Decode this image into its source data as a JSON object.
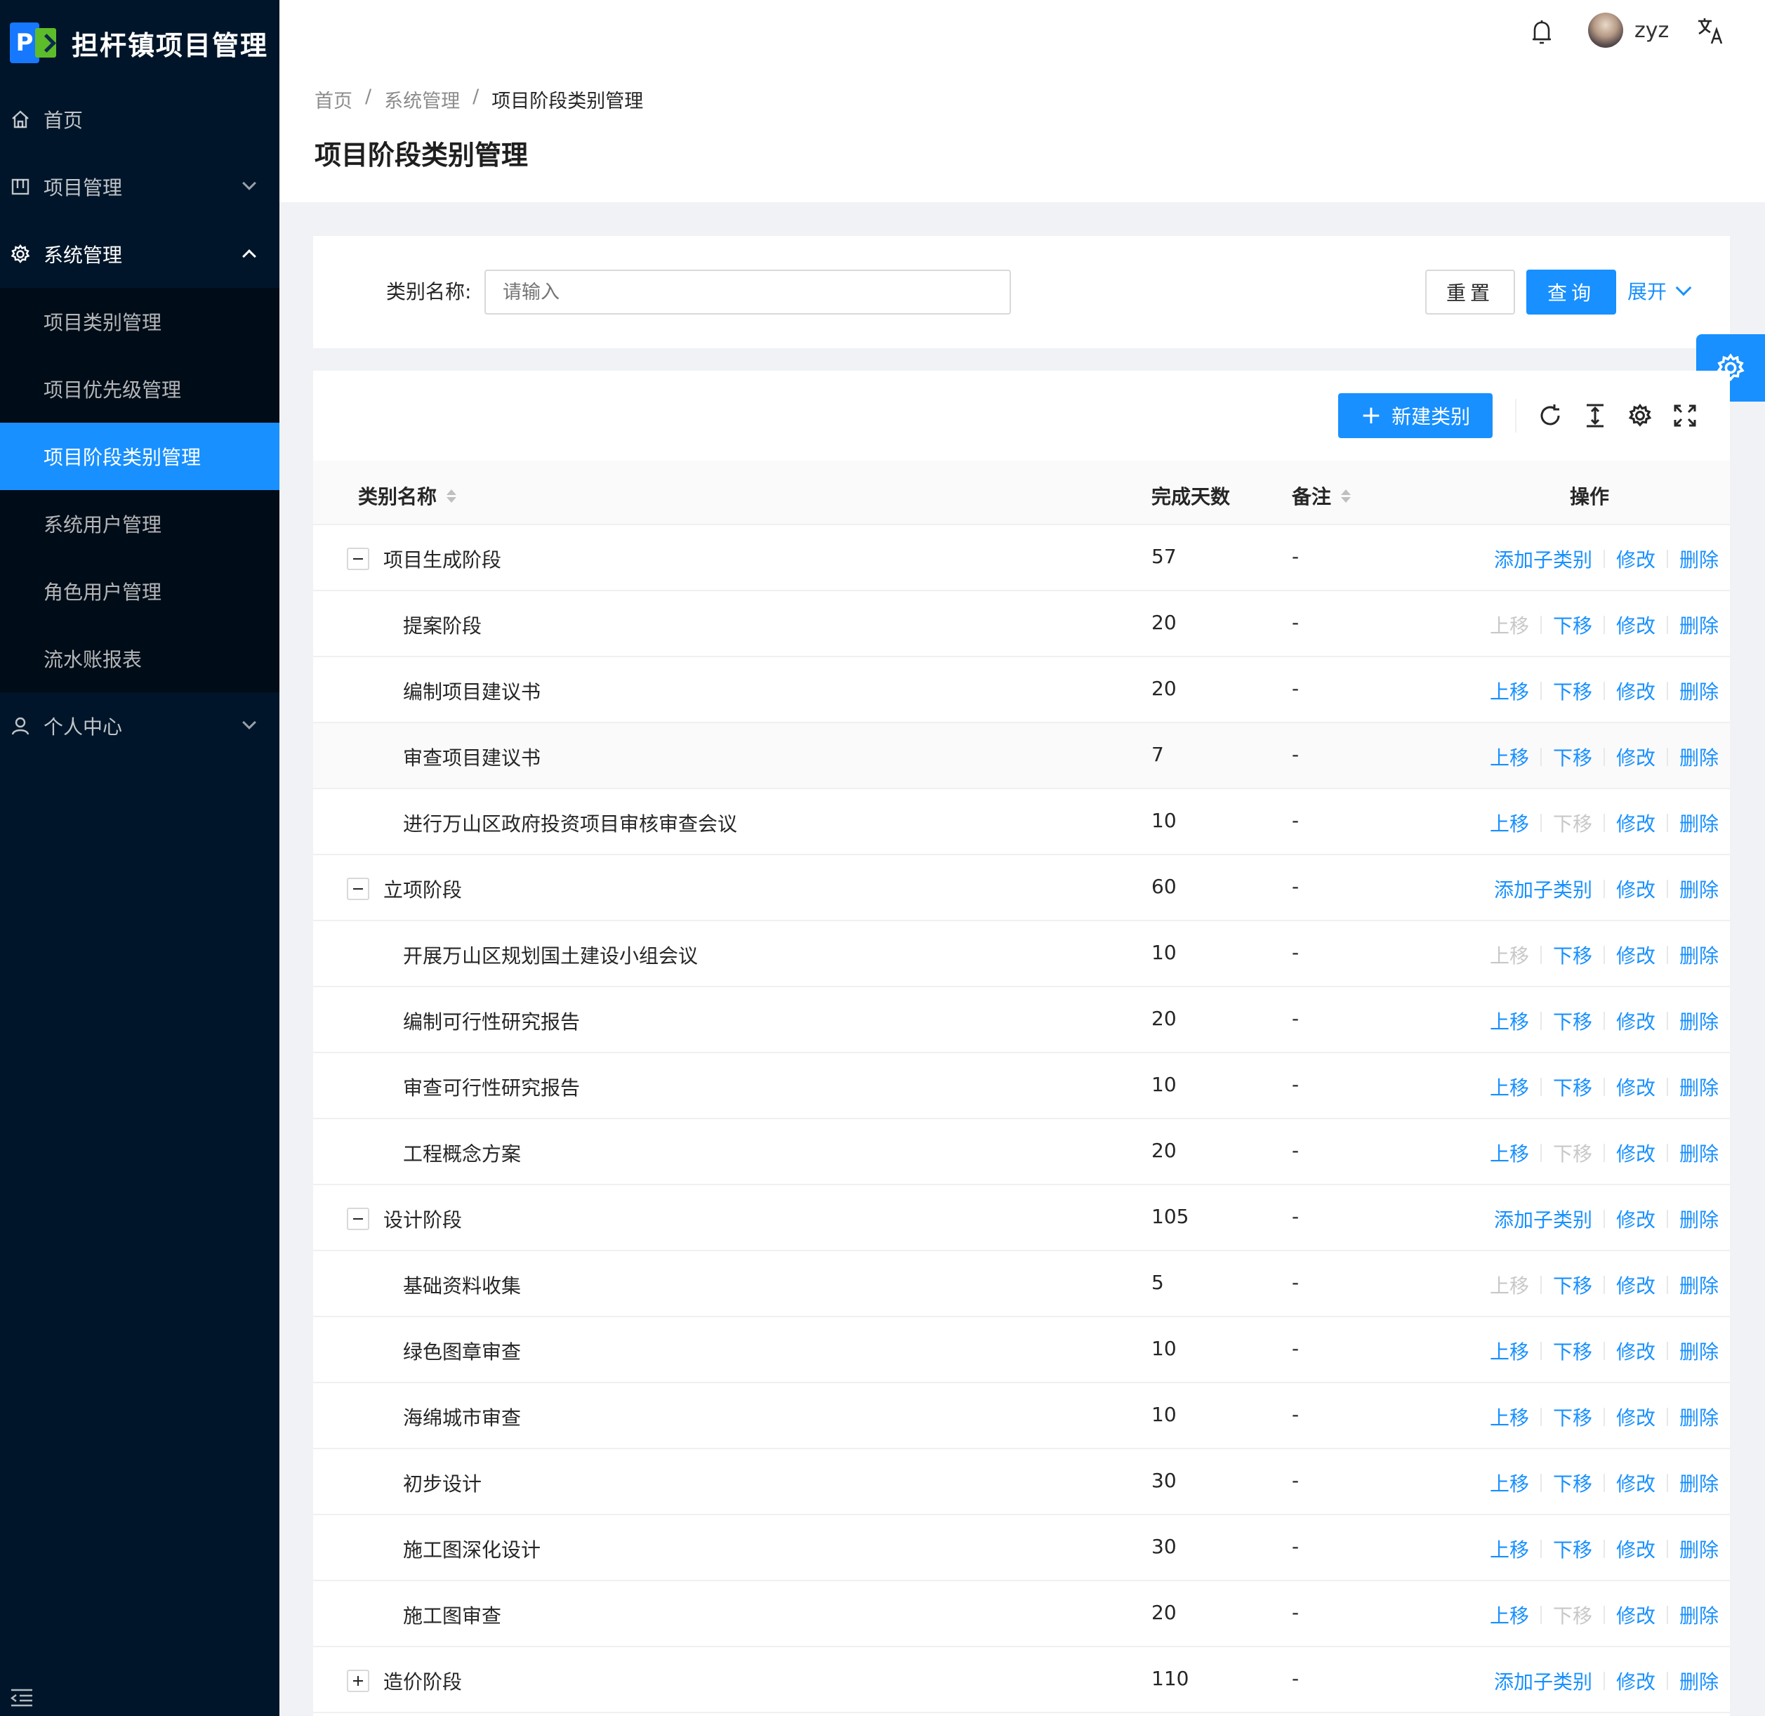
{
  "brand": {
    "title": "担杆镇项目管理",
    "logo_letter": "P"
  },
  "sidebar": {
    "items": [
      {
        "label": "首页",
        "icon": "home-icon"
      },
      {
        "label": "项目管理",
        "icon": "project-icon"
      },
      {
        "label": "系统管理",
        "icon": "gear-icon"
      },
      {
        "label": "个人中心",
        "icon": "user-icon"
      }
    ],
    "subitems": [
      {
        "label": "项目类别管理"
      },
      {
        "label": "项目优先级管理"
      },
      {
        "label": "项目阶段类别管理",
        "active": true
      },
      {
        "label": "系统用户管理"
      },
      {
        "label": "角色用户管理"
      },
      {
        "label": "流水账报表"
      }
    ]
  },
  "header": {
    "username": "zyz"
  },
  "breadcrumb": {
    "items": [
      "首页",
      "系统管理",
      "项目阶段类别管理"
    ],
    "separator": "/"
  },
  "page_title": "项目阶段类别管理",
  "search": {
    "label": "类别名称:",
    "placeholder": "请输入",
    "reset_label": "重置",
    "query_label": "查询",
    "expand_label": "展开"
  },
  "toolbar": {
    "new_label": "新建类别",
    "new_plus": "+"
  },
  "table": {
    "columns": [
      "类别名称",
      "完成天数",
      "备注",
      "操作"
    ],
    "op_labels": {
      "add_child": "添加子类别",
      "up": "上移",
      "down": "下移",
      "edit": "修改",
      "delete": "删除"
    },
    "rows": [
      {
        "name": "项目生成阶段",
        "days": "57",
        "note": "-",
        "level": 0,
        "expander": "minus"
      },
      {
        "name": "提案阶段",
        "days": "20",
        "note": "-",
        "level": 1,
        "up": false,
        "down": true
      },
      {
        "name": "编制项目建议书",
        "days": "20",
        "note": "-",
        "level": 1,
        "up": true,
        "down": true
      },
      {
        "name": "审查项目建议书",
        "days": "7",
        "note": "-",
        "level": 1,
        "up": true,
        "down": true,
        "highlight": true
      },
      {
        "name": "进行万山区政府投资项目审核审查会议",
        "days": "10",
        "note": "-",
        "level": 1,
        "up": true,
        "down": false
      },
      {
        "name": "立项阶段",
        "days": "60",
        "note": "-",
        "level": 0,
        "expander": "minus"
      },
      {
        "name": "开展万山区规划国土建设小组会议",
        "days": "10",
        "note": "-",
        "level": 1,
        "up": false,
        "down": true
      },
      {
        "name": "编制可行性研究报告",
        "days": "20",
        "note": "-",
        "level": 1,
        "up": true,
        "down": true
      },
      {
        "name": "审查可行性研究报告",
        "days": "10",
        "note": "-",
        "level": 1,
        "up": true,
        "down": true
      },
      {
        "name": "工程概念方案",
        "days": "20",
        "note": "-",
        "level": 1,
        "up": true,
        "down": false
      },
      {
        "name": "设计阶段",
        "days": "105",
        "note": "-",
        "level": 0,
        "expander": "minus"
      },
      {
        "name": "基础资料收集",
        "days": "5",
        "note": "-",
        "level": 1,
        "up": false,
        "down": true
      },
      {
        "name": "绿色图章审查",
        "days": "10",
        "note": "-",
        "level": 1,
        "up": true,
        "down": true
      },
      {
        "name": "海绵城市审查",
        "days": "10",
        "note": "-",
        "level": 1,
        "up": true,
        "down": true
      },
      {
        "name": "初步设计",
        "days": "30",
        "note": "-",
        "level": 1,
        "up": true,
        "down": true
      },
      {
        "name": "施工图深化设计",
        "days": "30",
        "note": "-",
        "level": 1,
        "up": true,
        "down": true
      },
      {
        "name": "施工图审查",
        "days": "20",
        "note": "-",
        "level": 1,
        "up": true,
        "down": false
      },
      {
        "name": "造价阶段",
        "days": "110",
        "note": "-",
        "level": 0,
        "expander": "plus"
      }
    ]
  },
  "colors": {
    "primary": "#1890ff",
    "sider_bg": "#001529",
    "disabled": "#c8c8c8"
  }
}
